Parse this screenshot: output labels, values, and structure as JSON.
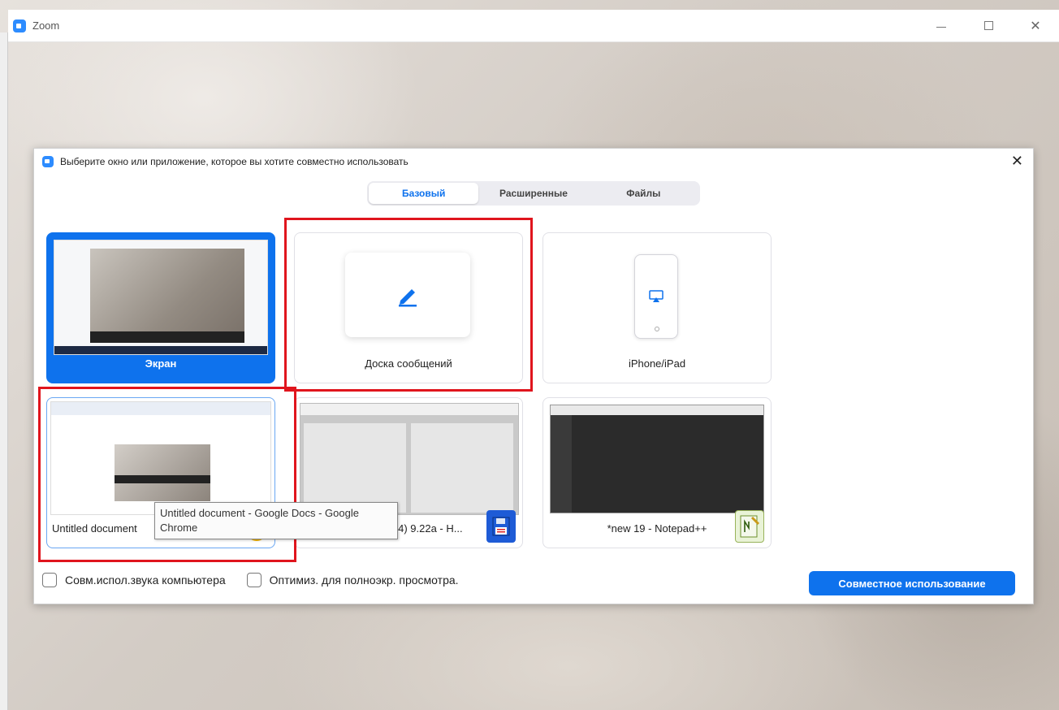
{
  "window": {
    "app_title": "Zoom",
    "controls": {
      "minimize": "—",
      "maximize": "□",
      "close": "✕"
    }
  },
  "dialog": {
    "title": "Выберите окно или приложение, которое вы хотите совместно использовать",
    "close": "✕",
    "tabs": [
      {
        "label": "Базовый",
        "active": true
      },
      {
        "label": "Расширенные",
        "active": false
      },
      {
        "label": "Файлы",
        "active": false
      }
    ],
    "tiles": [
      {
        "label": "Экран",
        "selected": true
      },
      {
        "label": "Доска сообщений",
        "icon": "pencil-icon"
      },
      {
        "label": "iPhone/iPad",
        "icon": "airplay-icon"
      },
      {
        "label": "Untitled document",
        "icon": "chrome-icon"
      },
      {
        "label": "x64) 9.22a - H...",
        "icon": "floppy-icon"
      },
      {
        "label": "*new 19 - Notepad++",
        "icon": "notepad-plus-plus-icon"
      }
    ],
    "tooltip": "Untitled document - Google Docs - Google Chrome",
    "checkboxes": [
      {
        "label": "Совм.испол.звука компьютера",
        "checked": false
      },
      {
        "label": "Оптимиз. для полноэкр. просмотра.",
        "checked": false
      }
    ],
    "share_button": "Совместное использование",
    "colors": {
      "accent": "#0e72ed",
      "highlight": "#e0151d"
    }
  }
}
